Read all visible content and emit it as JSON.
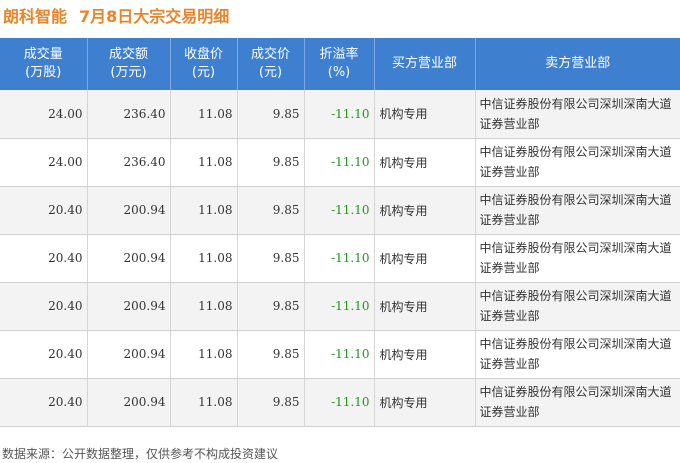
{
  "title": {
    "company": "朗科智能",
    "subtitle": "7月8日大宗交易明细"
  },
  "table": {
    "headers": [
      [
        "成交量",
        "(万股)"
      ],
      [
        "成交额",
        "(万元)"
      ],
      [
        "收盘价",
        "(元)"
      ],
      [
        "成交价",
        "(元)"
      ],
      [
        "折溢率",
        "(%)"
      ],
      [
        "买方营业部"
      ],
      [
        "卖方营业部"
      ]
    ],
    "rows": [
      [
        "24.00",
        "236.40",
        "11.08",
        "9.85",
        "-11.10",
        "机构专用",
        "中信证券股份有限公司深圳深南大道证券营业部"
      ],
      [
        "24.00",
        "236.40",
        "11.08",
        "9.85",
        "-11.10",
        "机构专用",
        "中信证券股份有限公司深圳深南大道证券营业部"
      ],
      [
        "20.40",
        "200.94",
        "11.08",
        "9.85",
        "-11.10",
        "机构专用",
        "中信证券股份有限公司深圳深南大道证券营业部"
      ],
      [
        "20.40",
        "200.94",
        "11.08",
        "9.85",
        "-11.10",
        "机构专用",
        "中信证券股份有限公司深圳深南大道证券营业部"
      ],
      [
        "20.40",
        "200.94",
        "11.08",
        "9.85",
        "-11.10",
        "机构专用",
        "中信证券股份有限公司深圳深南大道证券营业部"
      ],
      [
        "20.40",
        "200.94",
        "11.08",
        "9.85",
        "-11.10",
        "机构专用",
        "中信证券股份有限公司深圳深南大道证券营业部"
      ],
      [
        "20.40",
        "200.94",
        "11.08",
        "9.85",
        "-11.10",
        "机构专用",
        "中信证券股份有限公司深圳深南大道证券营业部"
      ]
    ]
  },
  "footer": "数据来源：公开数据整理，仅供参考不构成投资建议",
  "colors": {
    "title": "#e8852a",
    "header_bg": "#3e7fd0",
    "premium": "#1a9a1a",
    "row_alt": "#f3f3f3"
  }
}
